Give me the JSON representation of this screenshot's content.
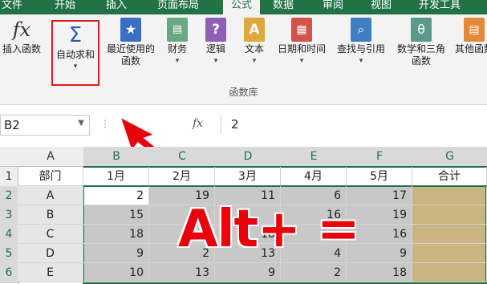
{
  "tabs": [
    "文件",
    "开始",
    "插入",
    "页面布局",
    "公式",
    "数据",
    "审阅",
    "视图",
    "开发工具"
  ],
  "ribbon": {
    "buttons": [
      {
        "label": "插入函数",
        "icon": "fx-icon"
      },
      {
        "label": "自动求和",
        "icon": "autosum-icon",
        "highlighted": true
      },
      {
        "label": "最近使用的函数",
        "icon": "star-icon"
      },
      {
        "label": "财务",
        "icon": "coins-icon"
      },
      {
        "label": "逻辑",
        "icon": "question-icon"
      },
      {
        "label": "文本",
        "icon": "text-icon"
      },
      {
        "label": "日期和时间",
        "icon": "calendar-icon"
      },
      {
        "label": "查找与引用",
        "icon": "lookup-icon"
      },
      {
        "label": "数学和三角函数",
        "icon": "theta-icon"
      },
      {
        "label": "其他函数",
        "icon": "more-functions-icon"
      }
    ],
    "group_label": "函数库"
  },
  "formula_bar": {
    "name_box": "B2",
    "fx_glyph": "fx",
    "value": "2"
  },
  "columns": [
    "A",
    "B",
    "C",
    "D",
    "E",
    "F",
    "G"
  ],
  "rows": [
    {
      "n": "1",
      "cells": [
        "部门",
        "1月",
        "2月",
        "3月",
        "4月",
        "5月",
        "合计"
      ]
    },
    {
      "n": "2",
      "cells": [
        "A",
        "2",
        "19",
        "11",
        "6",
        "17",
        ""
      ]
    },
    {
      "n": "3",
      "cells": [
        "B",
        "15",
        "",
        "",
        "16",
        "19",
        ""
      ]
    },
    {
      "n": "4",
      "cells": [
        "C",
        "18",
        "",
        "18",
        "",
        "16",
        ""
      ]
    },
    {
      "n": "5",
      "cells": [
        "D",
        "9",
        "2",
        "13",
        "4",
        "9",
        ""
      ]
    },
    {
      "n": "6",
      "cells": [
        "E",
        "10",
        "13",
        "9",
        "2",
        "18",
        ""
      ]
    }
  ],
  "overlay": {
    "text": "Alt+ ="
  },
  "colors": {
    "brand": "#217346",
    "highlight": "#e8000b",
    "selection": "#c8c8c8",
    "total_column": "#c9b57f"
  }
}
